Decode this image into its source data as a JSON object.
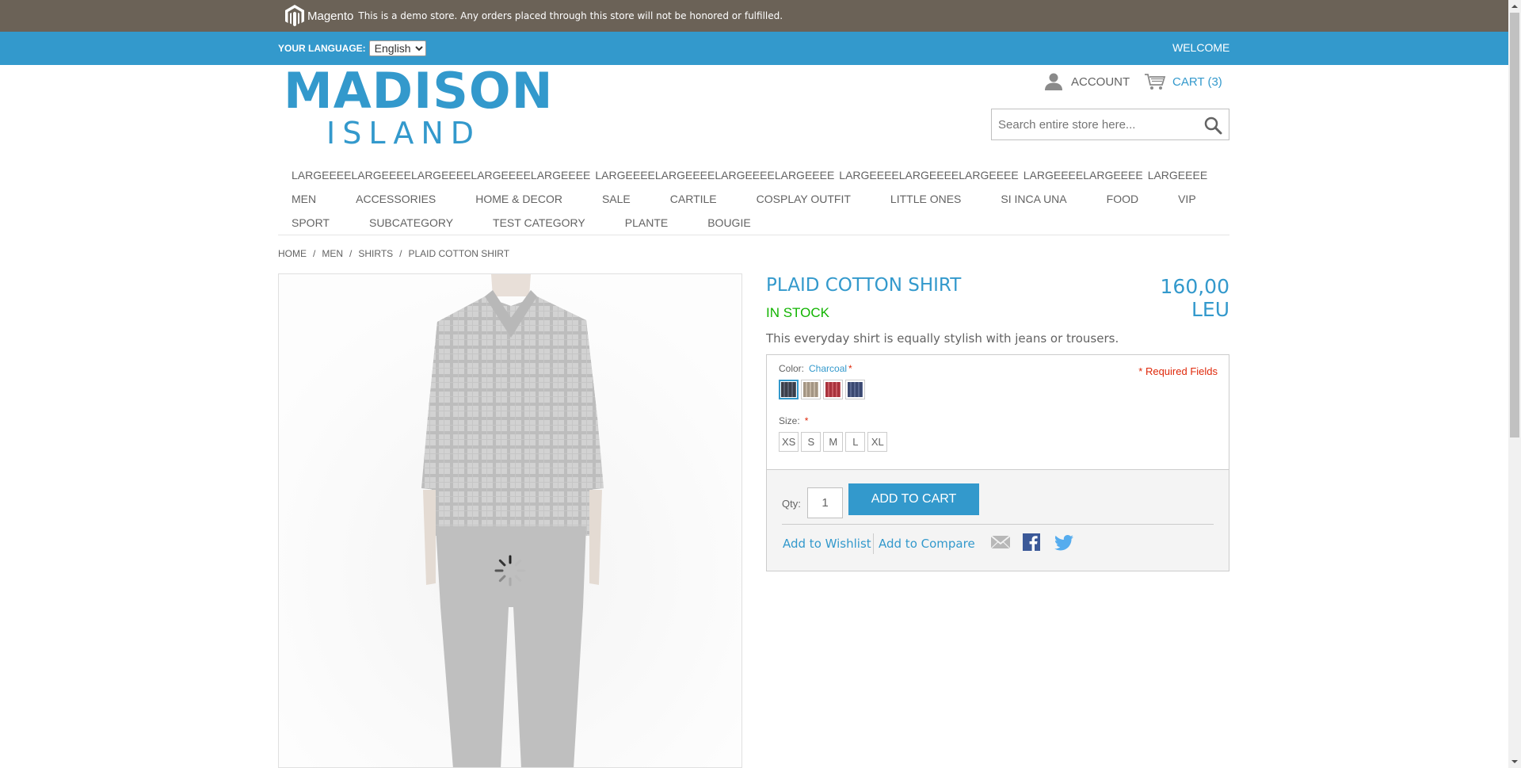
{
  "demo_notice": {
    "brand": "Magento",
    "text": "This is a demo store. Any orders placed through this store will not be honored or fulfilled."
  },
  "language_bar": {
    "label": "YOUR LANGUAGE:",
    "selected": "English",
    "welcome": "WELCOME"
  },
  "logo": {
    "line1": "MADISON",
    "line2": "ISLAND"
  },
  "header": {
    "account_label": "ACCOUNT",
    "cart_label": "CART (3)",
    "search_placeholder": "Search entire store here..."
  },
  "nav": {
    "row1": [
      "LARGEEEELARGEEEELARGEEEELARGEEEELARGEEEE",
      "LARGEEEELARGEEEELARGEEEELARGEEEE",
      "LARGEEEELARGEEEELARGEEEE",
      "LARGEEEELARGEEEE",
      "LARGEEEE"
    ],
    "row2": [
      "MEN",
      "ACCESSORIES",
      "HOME & DECOR",
      "SALE",
      "CARTILE",
      "COSPLAY OUTFIT",
      "LITTLE ONES",
      "SI INCA UNA",
      "FOOD",
      "VIP"
    ],
    "row3": [
      "SPORT",
      "SUBCATEGORY",
      "TEST CATEGORY",
      "PLANTE",
      "BOUGIE"
    ]
  },
  "breadcrumb": [
    "HOME",
    "MEN",
    "SHIRTS",
    "PLAID COTTON SHIRT"
  ],
  "breadcrumb_separator": "/",
  "product": {
    "name": "PLAID COTTON SHIRT",
    "price": "160,00 LEU",
    "stock": "IN STOCK",
    "short_description": "This everyday shirt is equally stylish with jeans or trousers.",
    "required_note": "* Required Fields",
    "color_label": "Color:",
    "color_value": "Charcoal",
    "required_star": "*",
    "size_label": "Size:",
    "swatches": [
      {
        "name": "Charcoal",
        "color": "#3a3f4a",
        "selected": true
      },
      {
        "name": "Khaki",
        "color": "#a39583",
        "selected": false
      },
      {
        "name": "Red",
        "color": "#a8323c",
        "selected": false
      },
      {
        "name": "Blue",
        "color": "#3a4870",
        "selected": false
      }
    ],
    "sizes": [
      "XS",
      "S",
      "M",
      "L",
      "XL"
    ],
    "qty_label": "Qty:",
    "qty_value": "1",
    "add_to_cart": "ADD TO CART",
    "wishlist": "Add to Wishlist",
    "compare": "Add to Compare",
    "share_icons": [
      "email-icon",
      "facebook-icon",
      "twitter-icon"
    ]
  },
  "colors": {
    "accent": "#3399cc",
    "demo_bar": "#6b6257",
    "in_stock": "#11b400",
    "required": "#df280a"
  }
}
